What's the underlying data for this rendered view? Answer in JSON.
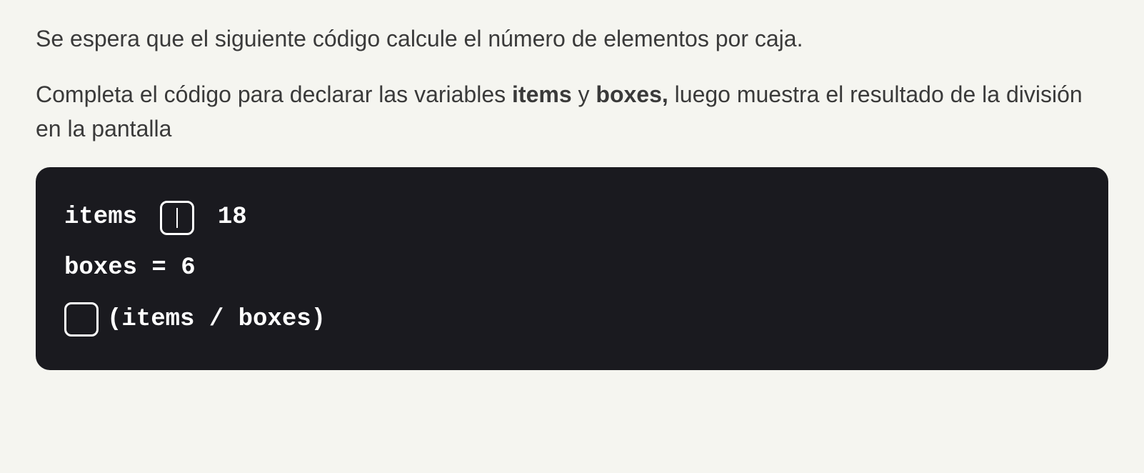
{
  "instructions": {
    "para1": "Se espera que el siguiente código calcule el número de elementos por caja.",
    "para2_prefix": "Completa el código para declarar las variables ",
    "para2_bold1": "items",
    "para2_mid": " y ",
    "para2_bold2": "boxes,",
    "para2_suffix": " luego muestra el resultado de la división en la pantalla"
  },
  "code": {
    "line1_pre": "items ",
    "line1_blank": "",
    "line1_post": " 18",
    "line2": "boxes = 6",
    "line3_blank": "",
    "line3_post": "(items / boxes)"
  }
}
